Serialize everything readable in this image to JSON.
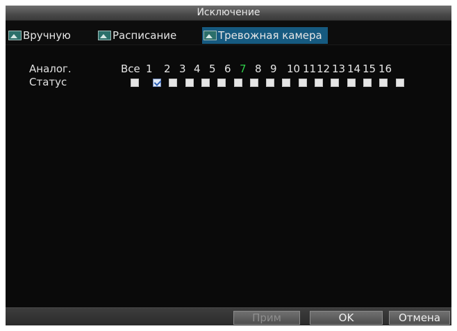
{
  "dialog": {
    "title": "Исключение"
  },
  "tabs": [
    {
      "label": "Вручную",
      "active": false,
      "icon": "image-icon"
    },
    {
      "label": "Расписание",
      "active": false,
      "icon": "image-icon"
    },
    {
      "label": "Тревожная камера",
      "active": true,
      "icon": "image-icon"
    }
  ],
  "grid": {
    "row_label_analog": "Аналог.",
    "row_label_status": "Статус",
    "all_label": "Все",
    "channels": [
      "1",
      "2",
      "3",
      "4",
      "5",
      "6",
      "7",
      "8",
      "9",
      "10",
      "11",
      "12",
      "13",
      "14",
      "15",
      "16"
    ],
    "checked": [
      false,
      true,
      false,
      false,
      false,
      false,
      false,
      false,
      false,
      false,
      false,
      false,
      false,
      false,
      false,
      false,
      false
    ]
  },
  "footer": {
    "apply_label": "Прим",
    "ok_label": "OK",
    "cancel_label": "Отмена"
  },
  "colors": {
    "tab_active": "#165a80",
    "channel_highlight": "#2fcf4a"
  }
}
